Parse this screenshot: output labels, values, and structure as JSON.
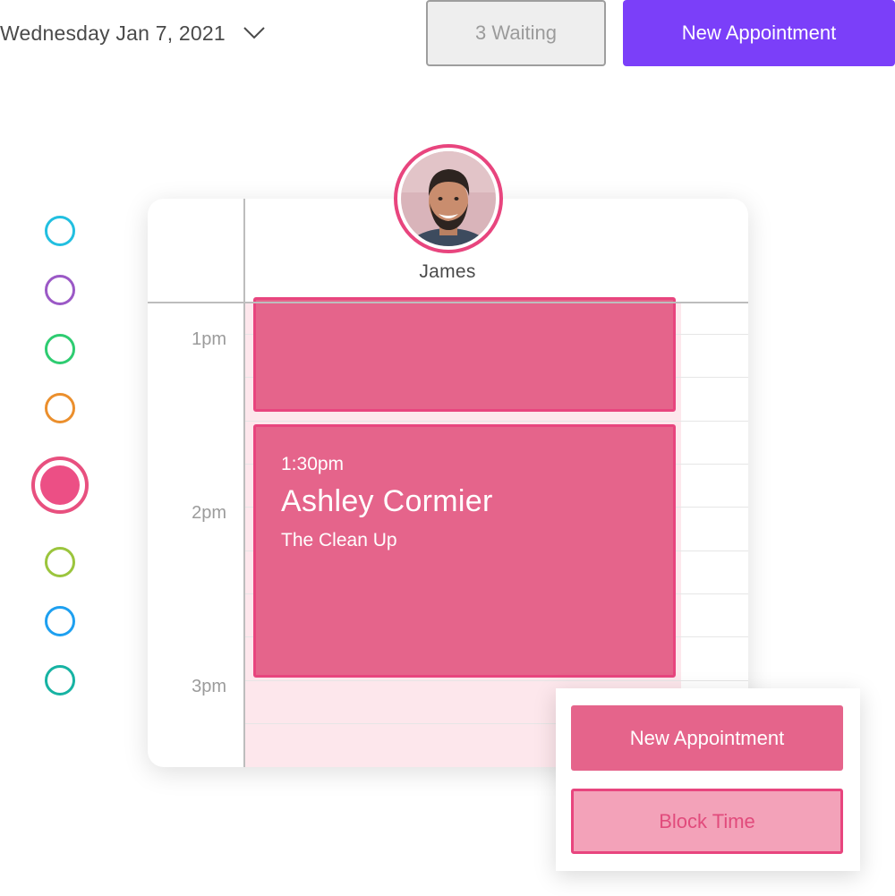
{
  "header": {
    "date_label": "Wednesday Jan 7, 2021",
    "date_dropdown_icon": "chevron-down-icon",
    "waiting_label": "3 Waiting",
    "new_appointment_label": "New Appointment"
  },
  "colors": {
    "accent_purple": "#7b3ff9",
    "pink": "#e8457e",
    "appointment_fill": "#e5648b",
    "column_fill": "#fde7ec",
    "color_options": [
      "#22bfe0",
      "#9b59c6",
      "#2ecc71",
      "#eb8f2d",
      "#ec4f85",
      "#9bc53d",
      "#1ea0f0",
      "#17b3a3"
    ],
    "selected_color": "#ec4f85"
  },
  "calendar": {
    "staff": {
      "name": "James",
      "avatar_icon": "staff-avatar"
    },
    "time_labels": [
      "1pm",
      "2pm",
      "3pm"
    ],
    "appointment": {
      "time": "1:30pm",
      "client": "Ashley Cormier",
      "service": "The Clean Up"
    }
  },
  "menu": {
    "new_appointment_label": "New Appointment",
    "block_time_label": "Block Time"
  }
}
